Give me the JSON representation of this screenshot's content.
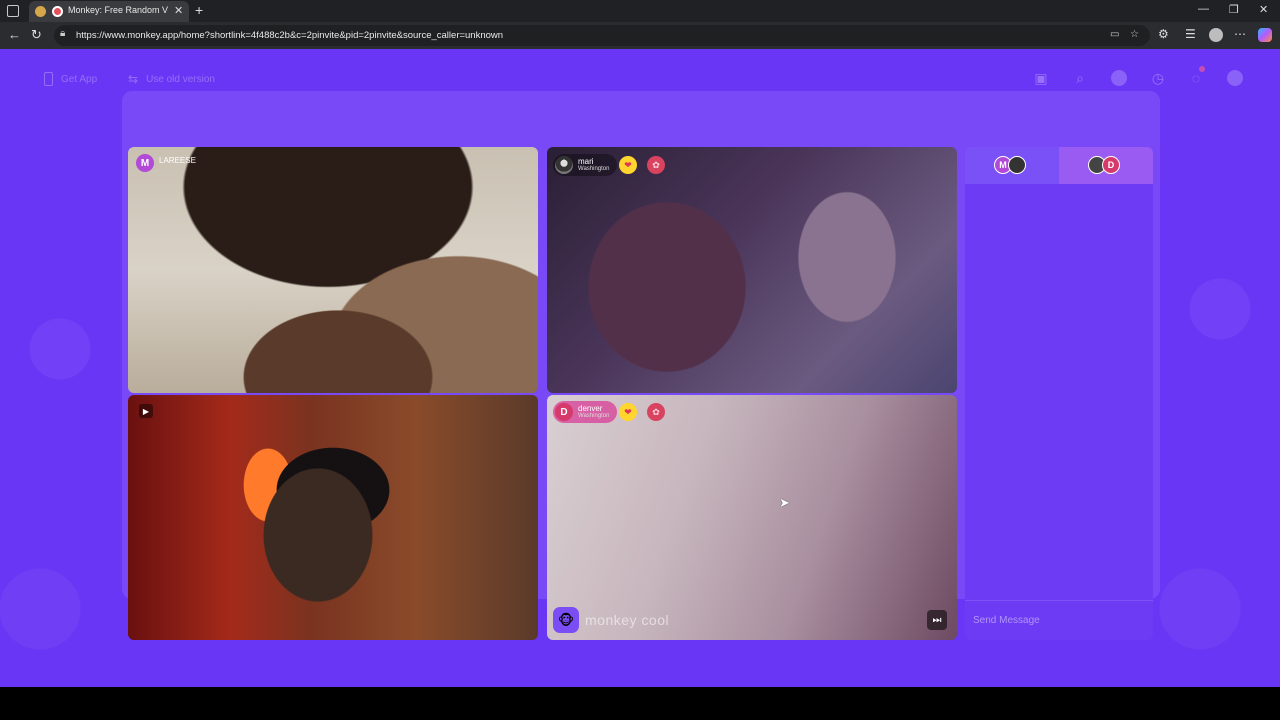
{
  "browser": {
    "tab_title": "Monkey: Free Random Video",
    "tab_close": "✕",
    "new_tab": "+",
    "url": "https://www.monkey.app/home?shortlink=4f488c2b&c=2pinvite&pid=2pinvite&source_caller=unknown",
    "window_controls": {
      "minimize": "—",
      "restore": "❐",
      "close": "✕"
    }
  },
  "topnav": {
    "get_app": "Get App",
    "use_old_version": "Use old version",
    "notification_badge": "1"
  },
  "tiles": {
    "top_left": {
      "avatar_letter": "M",
      "avatar_color": "#b24ad8",
      "name": "LAREESE"
    },
    "top_right": {
      "name": "mari",
      "location": "Washington"
    },
    "bottom_right": {
      "avatar_letter": "D",
      "avatar_color": "#d63a6b",
      "name": "denver",
      "location": "Washington"
    }
  },
  "brand": {
    "name": "monkey cool"
  },
  "chat": {
    "tab1_letter": "M",
    "tab2_letter": "D",
    "send_placeholder": "Send Message"
  },
  "colors": {
    "page_bg": "#6a36f5",
    "chat_bg": "#6d3bf3",
    "gold_badge": "#ffd52e",
    "rose_badge": "#d84360"
  },
  "icons": [
    "phone-icon",
    "swap-icon",
    "gift-icon",
    "search-icon",
    "globe-icon",
    "history-icon",
    "chat-icon",
    "profile-icon",
    "skip-icon",
    "camera-icon",
    "monkey-logo-icon"
  ]
}
